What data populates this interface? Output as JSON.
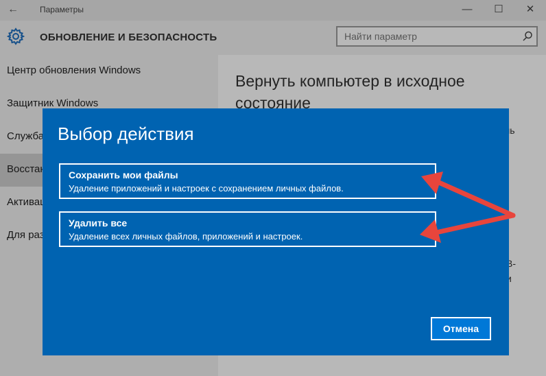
{
  "window": {
    "title": "Параметры",
    "back_icon": "←",
    "minimize_icon": "—",
    "maximize_icon": "☐",
    "close_icon": "✕"
  },
  "header": {
    "section_title": "ОБНОВЛЕНИЕ И БЕЗОПАСНОСТЬ",
    "icon": "gear-icon"
  },
  "search": {
    "placeholder": "Найти параметр",
    "icon": "search-icon"
  },
  "sidebar": {
    "items": [
      {
        "label": "Центр обновления Windows"
      },
      {
        "label": "Защитник Windows"
      },
      {
        "label": "Служба"
      },
      {
        "label": "Восстан",
        "active": true
      },
      {
        "label": "Активац"
      },
      {
        "label": "Для раз"
      }
    ]
  },
  "content": {
    "heading": "Вернуть компьютер в исходное состояние",
    "fragments": [
      "чь",
      "B-",
      "и"
    ]
  },
  "dialog": {
    "title": "Выбор действия",
    "options": [
      {
        "title": "Сохранить мои файлы",
        "description": "Удаление приложений и настроек с сохранением личных файлов."
      },
      {
        "title": "Удалить все",
        "description": "Удаление всех личных файлов, приложений и настроек."
      }
    ],
    "cancel_label": "Отмена"
  },
  "colors": {
    "dialog_bg": "#0063b1",
    "button_bg": "#0078d7",
    "annotation_arrow": "#e8453c",
    "sidebar_active": "#cfcfcf"
  }
}
